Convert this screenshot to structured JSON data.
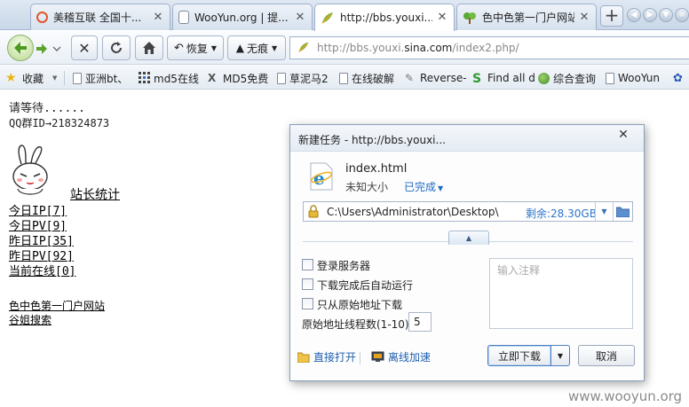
{
  "tabs": [
    {
      "label": "美稽互联 全国十...",
      "icon": "opera-icon",
      "active": false
    },
    {
      "label": "WooYun.org | 提...",
      "icon": "page-icon",
      "active": false
    },
    {
      "label": "http://bbs.youxi....",
      "icon": "leaf-icon",
      "active": true
    },
    {
      "label": "色中色第一门户网站",
      "icon": "tree-icon",
      "active": false
    }
  ],
  "toolbar": {
    "restore_label": "恢复",
    "incognito_label": "无痕",
    "url_prefix": "http://bbs.youxi.",
    "url_domain": "sina.com",
    "url_path": "/index2.php/"
  },
  "bookmarks": [
    {
      "label": "收藏",
      "icon": "star-icon"
    },
    {
      "label": "亚洲bt、",
      "icon": "page-icon"
    },
    {
      "label": "md5在线",
      "icon": "grid-icon"
    },
    {
      "label": "MD5免费",
      "icon": "x-page-icon"
    },
    {
      "label": "草泥马2",
      "icon": "page-icon"
    },
    {
      "label": "在线破解",
      "icon": "page-icon"
    },
    {
      "label": "Reverse-",
      "icon": "wand-icon"
    },
    {
      "label": "Find all d",
      "icon": "s-icon"
    },
    {
      "label": "综合查询",
      "icon": "globe-icon"
    },
    {
      "label": "WooYun",
      "icon": "page-icon"
    }
  ],
  "page": {
    "wait_text": "请等待......",
    "qq_text": "QQ群ID→218324873",
    "stats_title": "站长统计",
    "stats": [
      "今日IP[7]",
      "今日PV[9]",
      "昨日IP[35]",
      "昨日PV[92]",
      "当前在线[0]"
    ],
    "links": [
      "色中色第一门户网站",
      "谷姐搜索"
    ]
  },
  "dialog": {
    "title": "新建任务 - http://bbs.youxi...",
    "file_name": "index.html",
    "size_text": "未知大小",
    "status_text": "已完成",
    "save_path": "C:\\Users\\Administrator\\Desktop\\",
    "free_space": "剩余:28.30GB",
    "options": [
      "登录服务器",
      "下载完成后自动运行",
      "只从原始地址下载"
    ],
    "threads_label": "原始地址线程数(1-10)",
    "threads_value": "5",
    "note_placeholder": "输入注释",
    "open_direct": "直接打开",
    "offline_speedup": "离线加速",
    "download_now": "立即下载",
    "cancel": "取消"
  },
  "watermark": "www.wooyun.org"
}
